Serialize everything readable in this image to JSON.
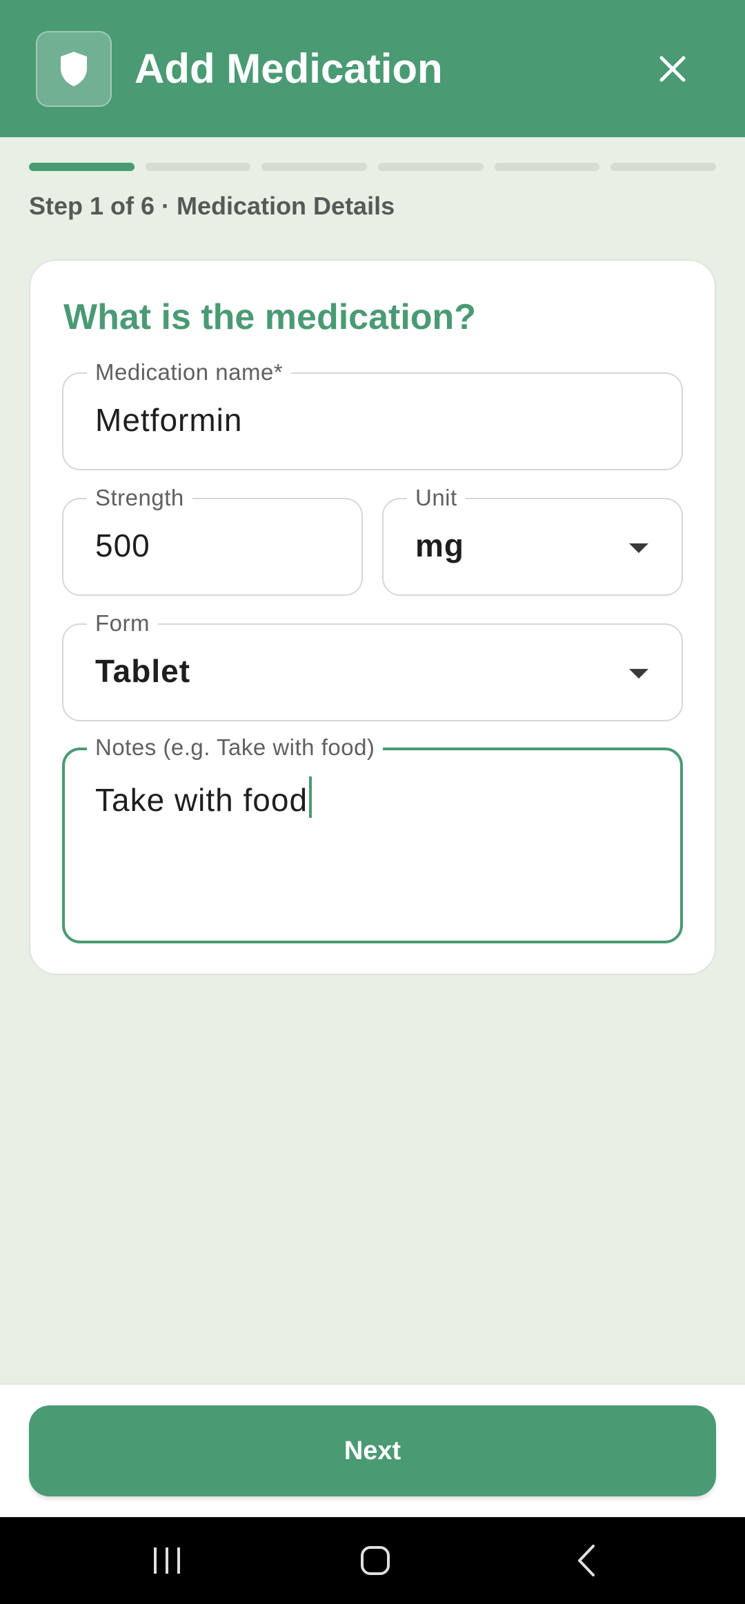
{
  "header": {
    "title": "Add Medication",
    "logo_icon": "shield-icon",
    "close_icon": "close-icon",
    "background_color": "#4a9a74"
  },
  "progress": {
    "current_step": 1,
    "total_steps": 6,
    "step_text": "Step 1 of 6 · Medication Details"
  },
  "card": {
    "title": "What is the medication?",
    "fields": {
      "name": {
        "label": "Medication name*",
        "value": "Metformin"
      },
      "strength": {
        "label": "Strength",
        "value": "500"
      },
      "unit": {
        "label": "Unit",
        "value": "mg"
      },
      "form": {
        "label": "Form",
        "value": "Tablet"
      },
      "notes": {
        "label": "Notes (e.g. Take with food)",
        "value": "Take with food"
      }
    }
  },
  "footer": {
    "next_label": "Next"
  },
  "system_nav": {
    "icons": [
      "recents-icon",
      "home-icon",
      "back-icon"
    ]
  },
  "colors": {
    "accent": "#4a9a74",
    "background": "#e8efe4"
  }
}
